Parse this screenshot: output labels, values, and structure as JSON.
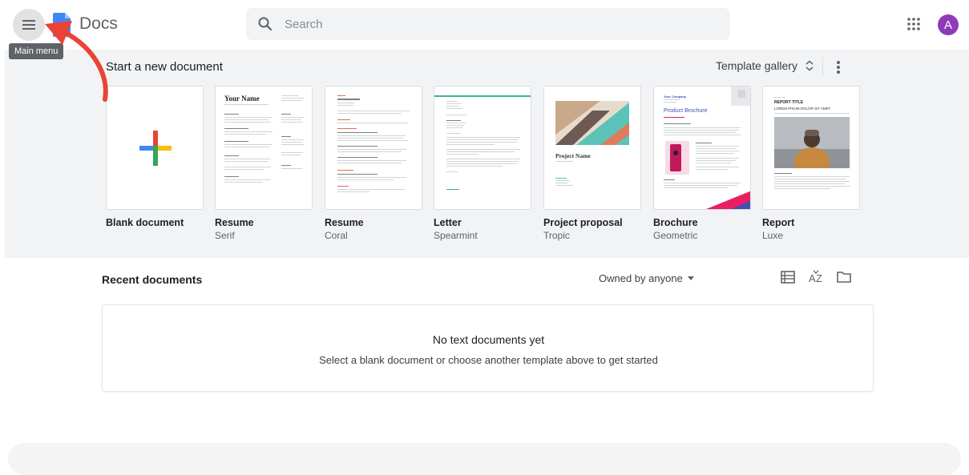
{
  "header": {
    "app_title": "Docs",
    "menu_tooltip": "Main menu",
    "search_placeholder": "Search",
    "avatar_letter": "A",
    "icons": [
      "hamburger-menu-icon",
      "docs-logo-icon",
      "search-icon",
      "apps-grid-icon"
    ]
  },
  "templates": {
    "section_title": "Start a new document",
    "gallery_label": "Template gallery",
    "items": [
      {
        "name": "Blank document",
        "sub": ""
      },
      {
        "name": "Resume",
        "sub": "Serif",
        "thumb_heading": "Your Name"
      },
      {
        "name": "Resume",
        "sub": "Coral"
      },
      {
        "name": "Letter",
        "sub": "Spearmint"
      },
      {
        "name": "Project proposal",
        "sub": "Tropic",
        "thumb_heading": "Project Name"
      },
      {
        "name": "Brochure",
        "sub": "Geometric",
        "thumb_heading": "Product Brochure",
        "thumb_company": "Your Company"
      },
      {
        "name": "Report",
        "sub": "Luxe",
        "thumb_heading": "REPORT TITLE",
        "thumb_subheading": "LOREM IPSUM DOLOR SIT AMET"
      }
    ]
  },
  "recent": {
    "title": "Recent documents",
    "owner_filter": "Owned by anyone",
    "empty_title": "No text documents yet",
    "empty_subtitle": "Select a blank document or choose another template above to get started"
  },
  "colors": {
    "accent_blue": "#4285f4",
    "avatar": "#8e3bb8",
    "annotation_arrow": "#ea4335",
    "panel_bg": "#f1f3f4"
  }
}
